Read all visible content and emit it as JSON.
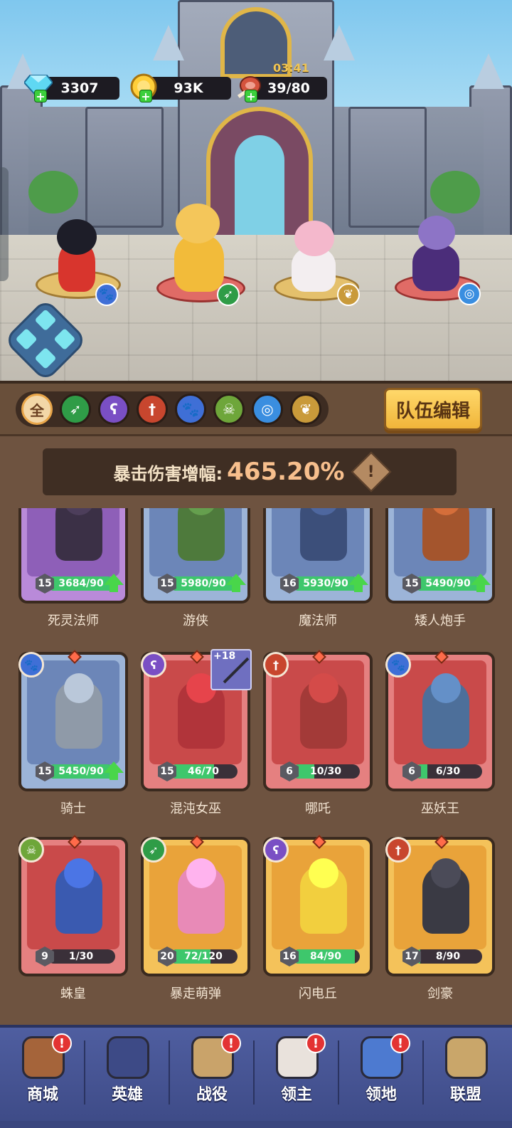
{
  "resources": {
    "gems": "3307",
    "gold": "93K",
    "food": "39/80",
    "timer": "03:41"
  },
  "scene_heroes": [
    {
      "name": "pirate-hero",
      "class_icon": "paw-icon"
    },
    {
      "name": "golden-knight-hero",
      "class_icon": "bow-icon"
    },
    {
      "name": "bunny-mage-hero",
      "class_icon": "wing-icon"
    },
    {
      "name": "dark-succubus-hero",
      "class_icon": "swirl-icon"
    }
  ],
  "filters": [
    {
      "label": "全",
      "icon": "all-icon",
      "color": "#f3d7a8"
    },
    {
      "label": "",
      "icon": "bow-icon",
      "color": "#2f9c47"
    },
    {
      "label": "",
      "icon": "staff-icon",
      "color": "#7a4fc4"
    },
    {
      "label": "",
      "icon": "sword-icon",
      "color": "#c8462e"
    },
    {
      "label": "",
      "icon": "paw-icon",
      "color": "#3f6fd6"
    },
    {
      "label": "",
      "icon": "skull-icon",
      "color": "#6ea63a"
    },
    {
      "label": "",
      "icon": "swirl-icon",
      "color": "#3a8ee0"
    },
    {
      "label": "",
      "icon": "wing-icon",
      "color": "#c99a3a"
    }
  ],
  "team_edit_label": "队伍编辑",
  "bonus": {
    "label": "暴击伤害增幅:",
    "value": "465.20%",
    "info": "!"
  },
  "cards": [
    {
      "name": "死灵法师",
      "level": "15",
      "progress": "3684/90",
      "fill": 1.0,
      "upgrade": true,
      "rarity": "purple",
      "badge": ""
    },
    {
      "name": "游侠",
      "level": "15",
      "progress": "5980/90",
      "fill": 1.0,
      "upgrade": true,
      "rarity": "blue",
      "badge": ""
    },
    {
      "name": "魔法师",
      "level": "16",
      "progress": "5930/90",
      "fill": 1.0,
      "upgrade": true,
      "rarity": "blue",
      "badge": ""
    },
    {
      "name": "矮人炮手",
      "level": "15",
      "progress": "5490/90",
      "fill": 1.0,
      "upgrade": true,
      "rarity": "blue",
      "badge": ""
    },
    {
      "name": "骑士",
      "level": "15",
      "progress": "5450/90",
      "fill": 1.0,
      "upgrade": true,
      "rarity": "blue",
      "badge": "paw-icon"
    },
    {
      "name": "混沌女巫",
      "level": "15",
      "progress": "46/70",
      "fill": 0.66,
      "upgrade": false,
      "rarity": "red",
      "badge": "staff-icon",
      "weapon_plus": "+18"
    },
    {
      "name": "哪吒",
      "level": "6",
      "progress": "10/30",
      "fill": 0.33,
      "upgrade": false,
      "rarity": "red",
      "badge": "sword-icon"
    },
    {
      "name": "巫妖王",
      "level": "6",
      "progress": "6/30",
      "fill": 0.2,
      "upgrade": false,
      "rarity": "red",
      "badge": "paw-icon"
    },
    {
      "name": "蛛皇",
      "level": "9",
      "progress": "1/30",
      "fill": 0.03,
      "upgrade": false,
      "rarity": "red",
      "badge": "skull-icon"
    },
    {
      "name": "暴走萌弹",
      "level": "20",
      "progress": "72/120",
      "fill": 0.6,
      "upgrade": false,
      "rarity": "gold",
      "badge": "bow-icon"
    },
    {
      "name": "闪电丘",
      "level": "16",
      "progress": "84/90",
      "fill": 0.93,
      "upgrade": false,
      "rarity": "gold",
      "badge": "staff-icon"
    },
    {
      "name": "剑豪",
      "level": "17",
      "progress": "8/90",
      "fill": 0.09,
      "upgrade": false,
      "rarity": "gold",
      "badge": "sword-icon"
    }
  ],
  "nav": [
    {
      "label": "商城",
      "icon": "shop-chest-icon",
      "alert": true
    },
    {
      "label": "英雄",
      "icon": "hero-cards-icon",
      "alert": false
    },
    {
      "label": "战役",
      "icon": "crossed-swords-icon",
      "alert": true
    },
    {
      "label": "领主",
      "icon": "lord-crown-icon",
      "alert": true
    },
    {
      "label": "领地",
      "icon": "castle-icon",
      "alert": true
    },
    {
      "label": "联盟",
      "icon": "knight-helmet-icon",
      "alert": false
    }
  ],
  "colors": {
    "panel": "#6e5340",
    "nav": "#4f5ea0",
    "accent_gold": "#f0b53a",
    "progress_green": "#3ec76c"
  }
}
